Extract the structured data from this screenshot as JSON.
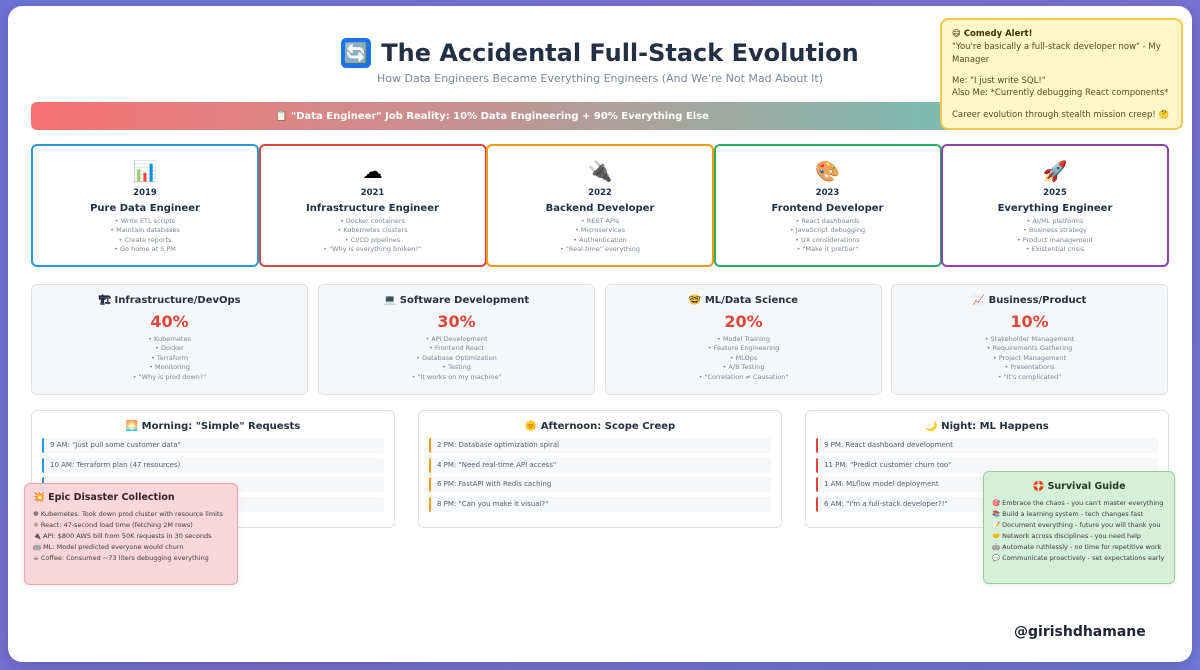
{
  "header": {
    "icon": "🔄",
    "title": "The Accidental Full-Stack Evolution",
    "subtitle": "How Data Engineers Became Everything Engineers (And We're Not Mad About It)"
  },
  "banner": {
    "text": "📋 \"Data Engineer\" Job Reality: 10% Data Engineering + 90% Everything Else"
  },
  "alert": {
    "title": "😄 Comedy Alert!",
    "line1": "\"You're basically a full-stack developer now\" - My Manager",
    "line2": "Me: \"I just write SQL!\"",
    "line3": "Also Me: *Currently debugging React components*",
    "line4": "Career evolution through stealth mission creep! 🤔"
  },
  "timeline": [
    {
      "icon": "📊",
      "year": "2019",
      "role": "Pure Data Engineer",
      "color": "#2a9bd6",
      "items": [
        "• Write ETL scripts",
        "• Maintain databases",
        "• Create reports",
        "• Go home at 5 PM"
      ]
    },
    {
      "icon": "☁",
      "year": "2021",
      "role": "Infrastructure Engineer",
      "color": "#e0453a",
      "items": [
        "• Docker containers",
        "• Kubernetes clusters",
        "• CI/CD pipelines",
        "• \"Why is everything broken?\""
      ]
    },
    {
      "icon": "🔌",
      "year": "2022",
      "role": "Backend Developer",
      "color": "#f39c12",
      "items": [
        "• REST APIs",
        "• Microservices",
        "• Authentication",
        "• \"Real-time\" everything"
      ]
    },
    {
      "icon": "🎨",
      "year": "2023",
      "role": "Frontend Developer",
      "color": "#27ae60",
      "items": [
        "• React dashboards",
        "• JavaScript debugging",
        "• UX considerations",
        "• \"Make it prettier\""
      ]
    },
    {
      "icon": "🚀",
      "year": "2025",
      "role": "Everything Engineer",
      "color": "#8e44ad",
      "items": [
        "• AI/ML platforms",
        "• Business strategy",
        "• Product management",
        "• Existential crisis"
      ]
    }
  ],
  "breakdown": [
    {
      "title": "🏗 Infrastructure/DevOps",
      "percent": "40%",
      "items": [
        "• Kubernetes",
        "• Docker",
        "• Terraform",
        "• Monitoring",
        "• \"Why is prod down?\""
      ]
    },
    {
      "title": "💻 Software Development",
      "percent": "30%",
      "items": [
        "• API Development",
        "• Frontend React",
        "• Database Optimization",
        "• Testing",
        "• \"It works on my machine\""
      ]
    },
    {
      "title": "🤓 ML/Data Science",
      "percent": "20%",
      "items": [
        "• Model Training",
        "• Feature Engineering",
        "• MLOps",
        "• A/B Testing",
        "• \"Correlation ≠ Causation\""
      ]
    },
    {
      "title": "📈 Business/Product",
      "percent": "10%",
      "items": [
        "• Stakeholder Management",
        "• Requirements Gathering",
        "• Project Management",
        "• Presentations",
        "• \"It's complicated\""
      ]
    }
  ],
  "day": [
    {
      "title": "🌅 Morning: \"Simple\" Requests",
      "color": "#2a9bd6",
      "rows": [
        "9 AM: \"Just pull some customer data\"",
        "10 AM: Terraform plan (47 resources)",
        "",
        ""
      ]
    },
    {
      "title": "🌞 Afternoon: Scope Creep",
      "color": "#f39c12",
      "rows": [
        "2 PM: Database optimization spiral",
        "4 PM: \"Need real-time API access\"",
        "6 PM: FastAPI with Redis caching",
        "8 PM: \"Can you make it visual?\""
      ]
    },
    {
      "title": "🌙 Night: ML Happens",
      "color": "#e0453a",
      "rows": [
        "9 PM: React dashboard development",
        "11 PM: \"Predict customer churn too\"",
        "1 AM: MLflow model deployment",
        "6 AM: \"I'm a full-stack developer?!\""
      ]
    }
  ],
  "disaster": {
    "title": "💥 Epic Disaster Collection",
    "items": [
      "☸ Kubernetes: Took down prod cluster with resource limits",
      "⚛ React: 47-second load time (fetching 2M rows)",
      "🔌 API: $800 AWS bill from 50K requests in 30 seconds",
      "🤖 ML: Model predicted everyone would churn",
      "☕ Coffee: Consumed ~73 liters debugging everything"
    ]
  },
  "survival": {
    "title": "🛟 Survival Guide",
    "items": [
      "🎯 Embrace the chaos - you can't master everything",
      "📚 Build a learning system - tech changes fast",
      "📝 Document everything - future you will thank you",
      "🤝 Network across disciplines - you need help",
      "🤖 Automate ruthlessly - no time for repetitive work",
      "💬 Communicate proactively - set expectations early"
    ]
  },
  "footer": {
    "handle": "@girishdhamane"
  }
}
